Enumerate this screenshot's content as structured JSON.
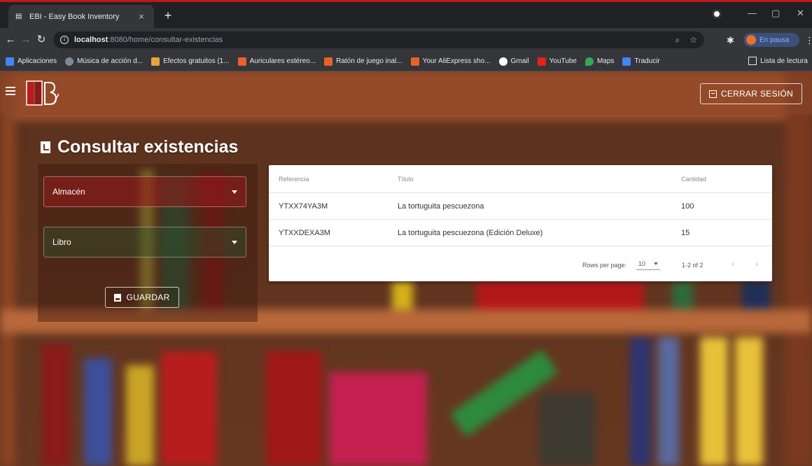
{
  "browser": {
    "tab_title": "EBI - Easy Book Inventory",
    "tab_close": "×",
    "new_tab": "+",
    "url_host": "localhost",
    "url_path": ":8080/home/consultar-existencias",
    "profile_label": "En pausa",
    "bookmarks": [
      {
        "label": "Aplicaciones",
        "color": "#4285f4"
      },
      {
        "label": "Música de acción d...",
        "color": "#7b8a9a"
      },
      {
        "label": "Efectos gratuitos (1...",
        "color": "#e8a33c"
      },
      {
        "label": "Auriculares estéreo...",
        "color": "#e8612b"
      },
      {
        "label": "Ratón de juego inal...",
        "color": "#e8612b"
      },
      {
        "label": "Your AliExpress sho...",
        "color": "#e8612b"
      },
      {
        "label": "Gmail",
        "color": "#ffffff"
      },
      {
        "label": "YouTube",
        "color": "#e62117"
      },
      {
        "label": "Maps",
        "color": "#34a853"
      },
      {
        "label": "Traducir",
        "color": "#4285f4"
      }
    ],
    "reading_list": "Lista de lectura"
  },
  "app": {
    "logout_label": "CERRAR SESIÓN",
    "page_title": "Consultar existencias",
    "form": {
      "warehouse_label": "Almacén",
      "book_label": "Libro",
      "save_label": "GUARDAR"
    },
    "table": {
      "columns": [
        "Referencia",
        "Título",
        "Cantidad"
      ],
      "rows": [
        {
          "ref": "YTXX74YA3M",
          "title": "La tortuguita pescuezona",
          "qty": "100"
        },
        {
          "ref": "YTXXDEXA3M",
          "title": "La tortuguita pescuezona (Edición Deluxe)",
          "qty": "15"
        }
      ],
      "rows_per_page_label": "Rows per page:",
      "rows_per_page_value": "10",
      "range_label": "1-2 of 2",
      "prev": "‹",
      "next": "›"
    }
  },
  "colors": {
    "accent_red": "#c0171f",
    "wood_brown": "#6b3a22"
  }
}
